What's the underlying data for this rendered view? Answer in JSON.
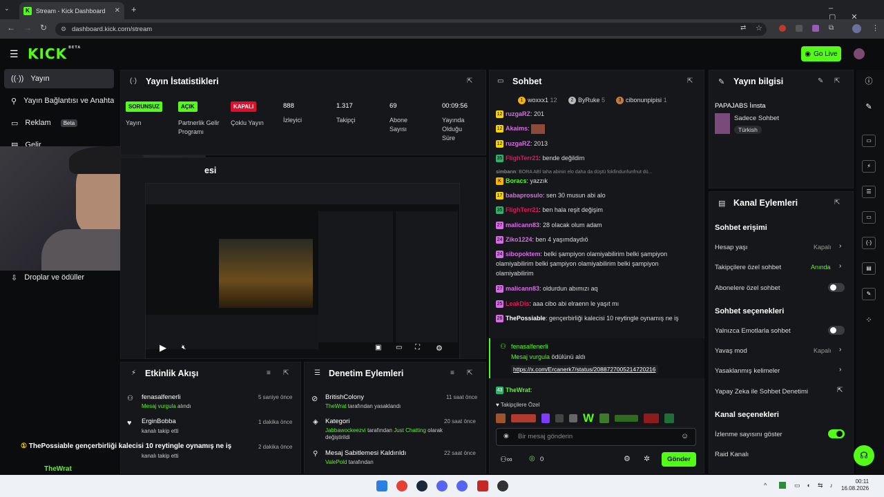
{
  "browser": {
    "tab_title": "Stream - Kick Dashboard",
    "url": "dashboard.kick.com/stream",
    "new_tab": "+",
    "nav_back": "←",
    "nav_forward": "→",
    "nav_reload": "↻"
  },
  "header": {
    "logo": "KICK",
    "logo_tag": "BETA",
    "go_live": "Go Live"
  },
  "sidebar": {
    "items": [
      {
        "label": "Yayın",
        "icon": "broadcast-icon"
      },
      {
        "label": "Yayın Bağlantısı ve Anahtar",
        "icon": "link-icon"
      },
      {
        "label": "Reklam",
        "badge": "Beta",
        "icon": "ad-icon"
      },
      {
        "label": "Gelir",
        "icon": "money-icon"
      },
      {
        "label": "Droplar ve ödüller",
        "icon": "drops-icon"
      }
    ]
  },
  "stats": {
    "title": "Yayın İstatistikleri",
    "items": [
      {
        "pill": "SORUNSUZ",
        "label": "Yayın"
      },
      {
        "pill": "AÇIK",
        "label": "Partnerlik Gelir Programı"
      },
      {
        "pill": "KAPALI",
        "label": "Çoklu Yayın"
      },
      {
        "value": "888",
        "label": "İzleyici"
      },
      {
        "value": "1.317",
        "label": "Takipçi"
      },
      {
        "value": "69",
        "label": "Abone Sayısı"
      },
      {
        "value": "00:09:56",
        "label": "Yayında Olduğu Süre"
      }
    ],
    "pill_colors": {
      "ok": "#53fc18",
      "off": "#e0102c"
    }
  },
  "preview": {
    "title_fragment": "esi",
    "play": "▶"
  },
  "activity": {
    "title": "Etkinlik Akışı",
    "items": [
      {
        "name": "fenasalfenerli",
        "sub": "Mesaj vurgula",
        "sub_suffix": "alındı",
        "time": "5 saniye önce"
      },
      {
        "name": "ErginBobba",
        "sub": "kanalı takip etti",
        "time": "1 dakika önce"
      },
      {
        "name": "",
        "sub": "kanalı takip etti",
        "time": "2 dakika önce"
      }
    ]
  },
  "moderation": {
    "title": "Denetim Eylemleri",
    "items": [
      {
        "name": "BritishColony",
        "actor": "TheWrat",
        "sub": "tarafından yasaklandı",
        "time": "11 saat önce"
      },
      {
        "name": "Kategori",
        "actor": "Jabbawockeezvi",
        "sub": "tarafından",
        "extra": "Just Chatting",
        "extra2": "olarak değiştirildi",
        "time": "20 saat önce"
      },
      {
        "name": "Mesaj Sabitlemesi Kaldırıldı",
        "actor": "ValePold",
        "sub": "tarafından",
        "time": "22 saat önce"
      }
    ]
  },
  "overlay": {
    "line1_user": "ThePossiable",
    "line1_text": "gençerbirliği kalecisi 10 reytingle oynamış ne iş",
    "line2_user": "TheWrat"
  },
  "chat": {
    "title": "Sohbet",
    "top_gifters": [
      {
        "rank": "1",
        "name": "woxxx1",
        "count": "12"
      },
      {
        "rank": "2",
        "name": "ByRuke",
        "count": "5"
      },
      {
        "rank": "3",
        "name": "cibonunpipisi",
        "count": "1"
      }
    ],
    "messages": [
      {
        "badge": "12",
        "user": "ruzgaRZ",
        "color": "#d96be8",
        "text": "201"
      },
      {
        "badge": "12",
        "user": "Akaims",
        "color": "#d96be8",
        "text": ""
      },
      {
        "badge": "12",
        "user": "ruzgaRZ",
        "color": "#d96be8",
        "text": "2013"
      },
      {
        "badge": "35",
        "user": "FlighTerr21",
        "color": "#e0185a",
        "text": "bende değildim"
      },
      {
        "badge": "",
        "user": "simbarın",
        "color": "#888888",
        "text": "BORA ABİ taha abinin elo daha da düştü fokfindunfunfnut dü..."
      },
      {
        "badge": "K",
        "user": "Boracs",
        "color": "#53fc18",
        "text": "yazzık"
      },
      {
        "badge": "17",
        "user": "babaprosulo",
        "color": "#d96be8",
        "text": "sen 30 musun abi alo"
      },
      {
        "badge": "35",
        "user": "FlighTerr21",
        "color": "#e0185a",
        "text": "ben hala reşit değişim"
      },
      {
        "badge": "27",
        "user": "malicann83",
        "color": "#d96be8",
        "text": "28 olacak olum adam"
      },
      {
        "badge": "24",
        "user": "Ziko1224",
        "color": "#d96be8",
        "text": "ben 4 yaşımdaydıö"
      },
      {
        "badge": "24",
        "user": "sibopoktem",
        "color": "#d96be8",
        "text": "belki şampiyon olamiyabilirim belki şampiyon olamiyabilirim belki şampiyon olamiyabilirim belki şampiyon olamiyabilirim"
      },
      {
        "badge": "27",
        "user": "malicann83",
        "color": "#d96be8",
        "text": "oldurdun abımızı aq"
      },
      {
        "badge": "25",
        "user": "LeakDis",
        "color": "#e0185a",
        "text": "aaa cibo abi elraenn le yaşıt mı"
      },
      {
        "badge": "26",
        "user": "ThePossiable",
        "color": "#ffffff",
        "text": "gençerbirliği kalecisi 10 reytingle oynamış ne iş"
      }
    ],
    "highlight": {
      "user": "fenasalfenerli",
      "line1": "Mesaj vurgula",
      "line1_suffix": "ödülünü aldı",
      "link": "https://x.com/Ercanerk7/status/2088727005214720216"
    },
    "last_msg": {
      "badge": "43",
      "user": "TheWrat"
    },
    "followers_only": "Takipçilere Özel",
    "emote_w": "W",
    "input_placeholder": "Bir mesaj gönderin",
    "infinity": "∞",
    "count": "0",
    "send": "Gönder"
  },
  "stream_info": {
    "title": "Yayın bilgisi",
    "stream_name": "PAPAJABS İınsta",
    "mode": "Sadece Sohbet",
    "language": "Türkish"
  },
  "channel": {
    "title": "Kanal Eylemleri",
    "sections": [
      {
        "heading": "Sohbet erişimi",
        "rows": [
          {
            "label": "Hesap yaşı",
            "value": "Kapalı",
            "control": "chevron"
          },
          {
            "label": "Takipçilere özel sohbet",
            "value": "Anında",
            "control": "chevron",
            "value_green": true
          },
          {
            "label": "Abonelere özel sohbet",
            "control": "toggle-off"
          }
        ]
      },
      {
        "heading": "Sohbet seçenekleri",
        "rows": [
          {
            "label": "Yalnızca Emotlarla sohbet",
            "control": "toggle-off"
          },
          {
            "label": "Yavaş mod",
            "value": "Kapalı",
            "control": "chevron"
          },
          {
            "label": "Yasaklanmış kelimeler",
            "control": "chevron"
          },
          {
            "label": "Yapay Zeka ile Sohbet Denetimi",
            "control": "external"
          }
        ]
      },
      {
        "heading": "Kanal seçenekleri",
        "rows": [
          {
            "label": "İzlenme sayısını göster",
            "control": "toggle-on"
          },
          {
            "label": "Raid Kanalı",
            "control": "none"
          }
        ]
      }
    ]
  },
  "taskbar": {
    "time": "00:11",
    "date": "16.08.2026"
  }
}
